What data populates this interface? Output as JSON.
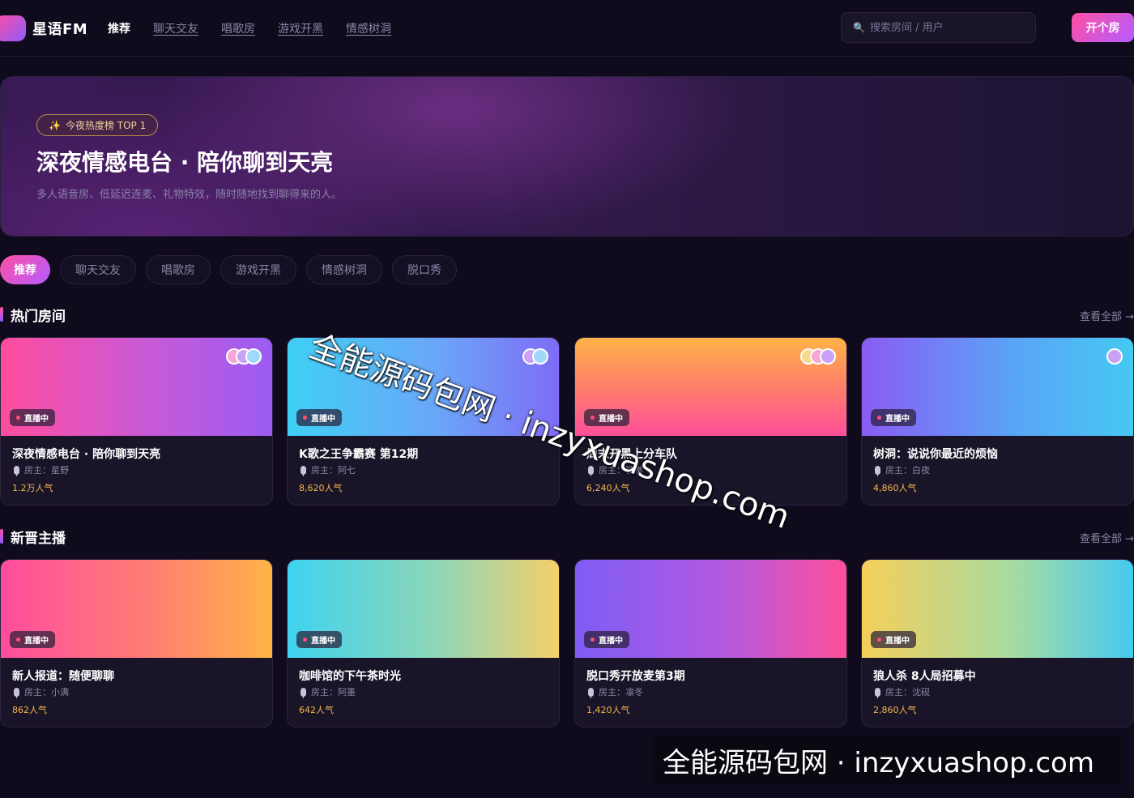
{
  "app": {
    "brand": "星语FM"
  },
  "nav": {
    "items": [
      "推荐",
      "聊天交友",
      "唱歌房",
      "游戏开黑",
      "情感树洞"
    ]
  },
  "search": {
    "icon": "search-icon",
    "placeholder": "搜索房间 / 用户"
  },
  "actions": {
    "open_room": "开个房"
  },
  "hero": {
    "badge": "今夜热度榜 TOP 1",
    "badge_icon": "✨",
    "title": "深夜情感电台 · 陪你聊到天亮",
    "subtitle": "多人语音房、低延迟连麦、礼物特效，随时随地找到聊得来的人。"
  },
  "chips": [
    "推荐",
    "聊天交友",
    "唱歌房",
    "游戏开黑",
    "情感树洞",
    "脱口秀"
  ],
  "hot": {
    "title": "热门房间",
    "more": "查看全部 →",
    "cards": [
      {
        "title": "深夜情感电台 · 陪你聊到天亮",
        "host": "房主：星野",
        "pop": "1.2万人气",
        "live": "直播中"
      },
      {
        "title": "K歌之王争霸赛 第12期",
        "host": "房主：阿七",
        "pop": "8,620人气",
        "live": "直播中"
      },
      {
        "title": "周末开黑上分车队",
        "host": "房主：铁拳",
        "pop": "6,240人气",
        "live": "直播中"
      },
      {
        "title": "树洞：说说你最近的烦恼",
        "host": "房主：白夜",
        "pop": "4,860人气",
        "live": "直播中"
      }
    ]
  },
  "new": {
    "title": "新晋主播",
    "more": "查看全部 →",
    "cards": [
      {
        "title": "新人报道：随便聊聊",
        "host": "房主：小满",
        "pop": "862人气",
        "live": "直播中"
      },
      {
        "title": "咖啡馆的下午茶时光",
        "host": "房主：阿墨",
        "pop": "642人气",
        "live": "直播中"
      },
      {
        "title": "脱口秀开放麦第3期",
        "host": "房主：凛冬",
        "pop": "1,420人气",
        "live": "直播中"
      },
      {
        "title": "狼人杀 8人局招募中",
        "host": "房主：沈砚",
        "pop": "2,860人气",
        "live": "直播中"
      }
    ]
  },
  "colors": {
    "accent_pink": "#ff4fa3",
    "accent_purple": "#8e5cff",
    "popularity": "#f5b74a",
    "background": "#0f0a1c"
  },
  "watermark": {
    "diagonal": "全能源码包网 · inzyxuashop.com",
    "box": "全能源码包网 · inzyxuashop.com"
  }
}
